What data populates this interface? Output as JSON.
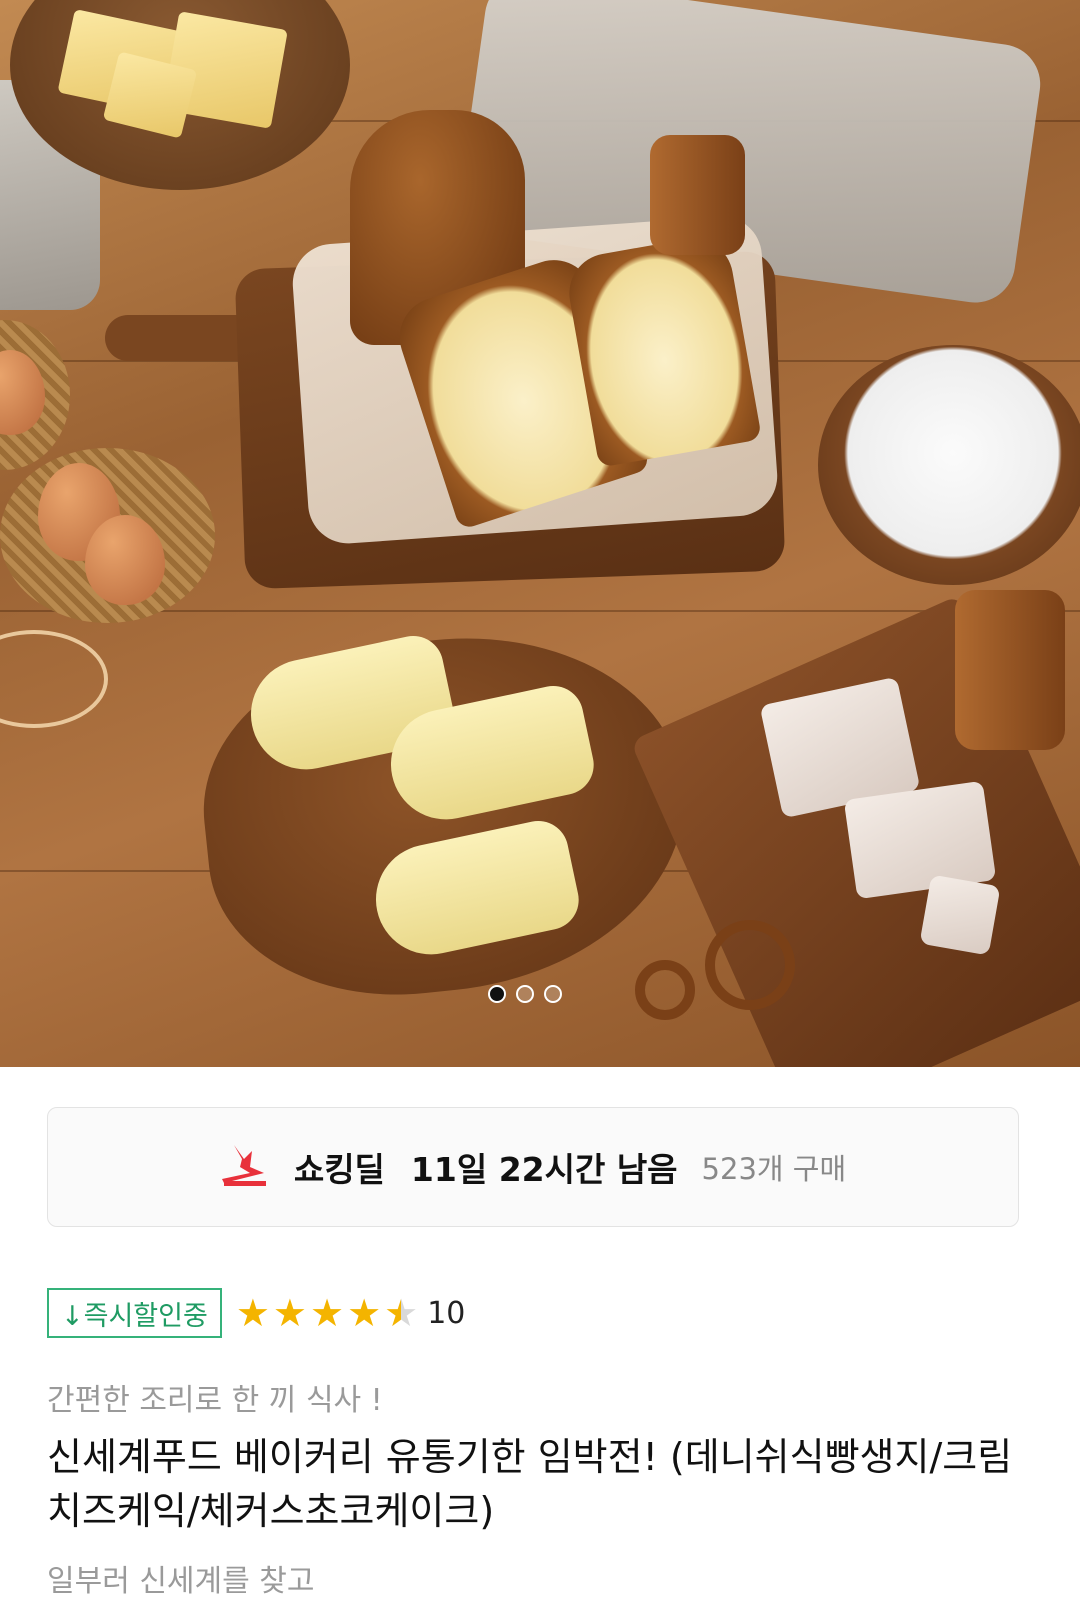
{
  "carousel": {
    "image_alt": "bakery bread and dough on wooden table",
    "dot_count": 3,
    "active_index": 0
  },
  "deal": {
    "name": "쇼킹딜",
    "time_left": "11일 22시간 남음",
    "purchase_count": "523개 구매",
    "icon": "lightning-bolt-icon",
    "icon_color": "#e8313b"
  },
  "product": {
    "badge": "↓즉시할인중",
    "badge_color": "#35b27a",
    "rating": 4.5,
    "review_count": "10",
    "subtitle": "간편한 조리로 한 끼 식사 !",
    "title": "신세계푸드 베이커리 유통기한 임박전! (데니쉬식빵생지/크림치즈케익/체커스초코케이크)",
    "cutoff_line": "일부러 신세계를 찾고"
  },
  "colors": {
    "star": "#f4b400",
    "star_empty": "#d9d9d9"
  }
}
